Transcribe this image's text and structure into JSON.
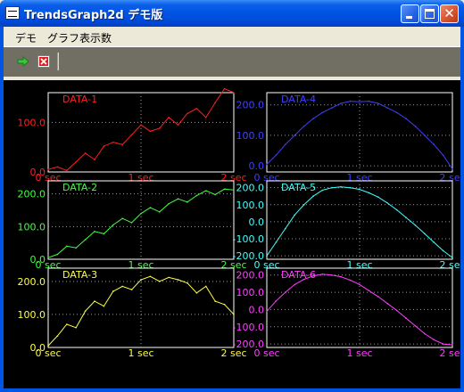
{
  "window": {
    "title": "TrendsGraph2d デモ版"
  },
  "menu": {
    "items": [
      "デモ",
      "グラフ表示数"
    ]
  },
  "toolbar": {
    "buttons": [
      {
        "name": "start",
        "icon": "green-arrow-icon"
      },
      {
        "name": "stop",
        "icon": "red-x-icon"
      }
    ]
  },
  "charts": [
    {
      "title": "DATA-1",
      "color": "#ff2020",
      "yticks": [
        "100.0",
        "0.0"
      ],
      "xticks": [
        "0 sec",
        "1 sec",
        "2 sec"
      ]
    },
    {
      "title": "DATA-2",
      "color": "#40ff40",
      "yticks": [
        "200.0",
        "100.0",
        "0.0"
      ],
      "xticks": [
        "0 sec",
        "1 sec",
        "2 sec"
      ]
    },
    {
      "title": "DATA-3",
      "color": "#ffff40",
      "yticks": [
        "200.0",
        "100.0",
        "0.0"
      ],
      "xticks": [
        "0 sec",
        "1 sec",
        "2 sec"
      ]
    },
    {
      "title": "DATA-4",
      "color": "#4040ff",
      "yticks": [
        "200.0",
        "100.0",
        "0.0"
      ],
      "xticks": [
        "0 sec",
        "1 sec",
        "2 sec"
      ]
    },
    {
      "title": "DATA-5",
      "color": "#40ffff",
      "yticks": [
        "200.0",
        "100.0",
        "0.0",
        "-100.0",
        "-200.0"
      ],
      "xticks": [
        "0 sec",
        "1 sec",
        "2 sec"
      ]
    },
    {
      "title": "DATA-6",
      "color": "#ff40ff",
      "yticks": [
        "200.0",
        "100.0",
        "0.0",
        "-100.0",
        "-200.0"
      ],
      "xticks": [
        "0 sec",
        "1 sec",
        "2 sec"
      ]
    }
  ],
  "chart_data": [
    {
      "type": "line",
      "title": "DATA-1",
      "ylim": [
        0,
        160
      ],
      "xlim": [
        0,
        2
      ],
      "x_unit": "sec",
      "x": [
        0,
        0.1,
        0.2,
        0.3,
        0.4,
        0.5,
        0.6,
        0.7,
        0.8,
        0.9,
        1.0,
        1.1,
        1.2,
        1.3,
        1.4,
        1.5,
        1.6,
        1.7,
        1.8,
        1.9,
        2.0
      ],
      "series": [
        {
          "color": "#ff2020",
          "values": [
            5,
            10,
            3,
            20,
            38,
            25,
            52,
            60,
            55,
            75,
            95,
            82,
            88,
            110,
            95,
            118,
            128,
            110,
            140,
            168,
            160
          ]
        }
      ]
    },
    {
      "type": "line",
      "title": "DATA-2",
      "ylim": [
        0,
        240
      ],
      "xlim": [
        0,
        2
      ],
      "x_unit": "sec",
      "x": [
        0,
        0.1,
        0.2,
        0.3,
        0.4,
        0.5,
        0.6,
        0.7,
        0.8,
        0.9,
        1.0,
        1.1,
        1.2,
        1.3,
        1.4,
        1.5,
        1.6,
        1.7,
        1.8,
        1.9,
        2.0
      ],
      "series": [
        {
          "color": "#40ff40",
          "values": [
            5,
            15,
            40,
            35,
            60,
            85,
            78,
            105,
            125,
            112,
            140,
            158,
            145,
            170,
            185,
            175,
            195,
            210,
            198,
            215,
            212
          ]
        }
      ]
    },
    {
      "type": "line",
      "title": "DATA-3",
      "ylim": [
        0,
        240
      ],
      "xlim": [
        0,
        2
      ],
      "x_unit": "sec",
      "x": [
        0,
        0.1,
        0.2,
        0.3,
        0.4,
        0.5,
        0.6,
        0.7,
        0.8,
        0.9,
        1.0,
        1.1,
        1.2,
        1.3,
        1.4,
        1.5,
        1.6,
        1.7,
        1.8,
        1.9,
        2.0
      ],
      "series": [
        {
          "color": "#ffff40",
          "values": [
            5,
            35,
            70,
            60,
            110,
            140,
            125,
            170,
            185,
            175,
            205,
            215,
            200,
            212,
            205,
            195,
            165,
            185,
            140,
            130,
            100
          ]
        }
      ]
    },
    {
      "type": "line",
      "title": "DATA-4",
      "ylim": [
        -20,
        240
      ],
      "xlim": [
        0,
        2
      ],
      "x_unit": "sec",
      "x": [
        0,
        0.1,
        0.2,
        0.3,
        0.4,
        0.5,
        0.6,
        0.7,
        0.8,
        0.9,
        1.0,
        1.1,
        1.2,
        1.3,
        1.4,
        1.5,
        1.6,
        1.7,
        1.8,
        1.9,
        2.0
      ],
      "series": [
        {
          "color": "#4040ff",
          "values": [
            5,
            35,
            70,
            100,
            130,
            155,
            175,
            190,
            205,
            212,
            210,
            212,
            205,
            190,
            175,
            155,
            130,
            100,
            70,
            35,
            -10
          ]
        }
      ]
    },
    {
      "type": "line",
      "title": "DATA-5",
      "ylim": [
        -220,
        240
      ],
      "xlim": [
        0,
        2
      ],
      "x_unit": "sec",
      "x": [
        0,
        0.1,
        0.2,
        0.3,
        0.4,
        0.5,
        0.6,
        0.7,
        0.8,
        0.9,
        1.0,
        1.1,
        1.2,
        1.3,
        1.4,
        1.5,
        1.6,
        1.7,
        1.8,
        1.9,
        2.0
      ],
      "series": [
        {
          "color": "#40ffff",
          "values": [
            -200,
            -120,
            -40,
            40,
            100,
            150,
            185,
            200,
            205,
            200,
            190,
            170,
            145,
            110,
            70,
            25,
            -20,
            -70,
            -120,
            -170,
            -210
          ]
        }
      ]
    },
    {
      "type": "line",
      "title": "DATA-6",
      "ylim": [
        -220,
        240
      ],
      "xlim": [
        0,
        2
      ],
      "x_unit": "sec",
      "x": [
        0,
        0.1,
        0.2,
        0.3,
        0.4,
        0.5,
        0.6,
        0.7,
        0.8,
        0.9,
        1.0,
        1.1,
        1.2,
        1.3,
        1.4,
        1.5,
        1.6,
        1.7,
        1.8,
        1.9,
        2.0
      ],
      "series": [
        {
          "color": "#ff40ff",
          "values": [
            -10,
            50,
            100,
            145,
            175,
            195,
            205,
            200,
            190,
            170,
            145,
            110,
            75,
            35,
            -5,
            -50,
            -95,
            -140,
            -175,
            -200,
            -205
          ]
        }
      ]
    }
  ]
}
